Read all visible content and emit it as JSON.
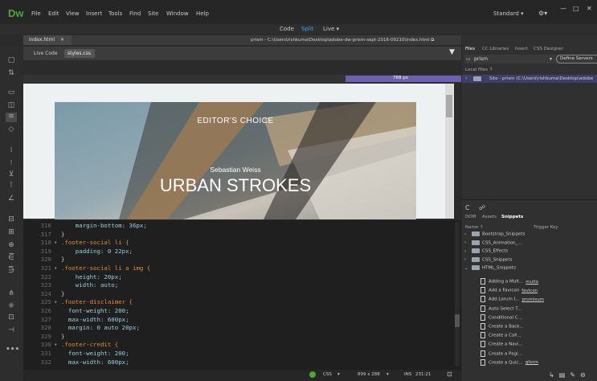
{
  "app": {
    "logo": "Dw",
    "accent": "#4ea53a"
  },
  "menu": [
    "File",
    "Edit",
    "View",
    "Insert",
    "Tools",
    "Find",
    "Site",
    "Window",
    "Help"
  ],
  "workspace": "Standard",
  "window_controls": {
    "minimize": "—",
    "maximize": "□",
    "close": "✕"
  },
  "view_modes": {
    "code": "Code",
    "split": "Split",
    "live": "Live"
  },
  "doc_tab": "index.html",
  "doc_path": "prism - C:\\Users\\rishkuma\\Desktop\\adobe-dw-prism-sept-2016-09210\\index.html",
  "related_files": [
    "Live Code",
    "styles.css"
  ],
  "media_query": "768 px",
  "preview": {
    "kicker": "EDITOR'S CHOICE",
    "author": "Sebastian Weiss",
    "headline": "URBAN STROKES"
  },
  "code_lines": [
    {
      "n": "316",
      "text": "    margin-bottom: 36px;",
      "kind": "prop"
    },
    {
      "n": "317",
      "text": "}",
      "kind": "brace"
    },
    {
      "n": "318",
      "text": ".footer-social li {",
      "kind": "sel",
      "fold": true
    },
    {
      "n": "319",
      "text": "    padding: 0 22px;",
      "kind": "prop"
    },
    {
      "n": "320",
      "text": "}",
      "kind": "brace"
    },
    {
      "n": "321",
      "text": ".footer-social li a img {",
      "kind": "sel",
      "fold": true
    },
    {
      "n": "322",
      "text": "    height: 20px;",
      "kind": "prop"
    },
    {
      "n": "323",
      "text": "    width: auto;",
      "kind": "prop"
    },
    {
      "n": "324",
      "text": "}",
      "kind": "brace"
    },
    {
      "n": "325",
      "text": ".footer-disclaimer {",
      "kind": "sel",
      "fold": true
    },
    {
      "n": "326",
      "text": "  font-weight: 200;",
      "kind": "prop"
    },
    {
      "n": "327",
      "text": "  max-width: 600px;",
      "kind": "prop"
    },
    {
      "n": "328",
      "text": "  margin: 0 auto 20px;",
      "kind": "prop"
    },
    {
      "n": "329",
      "text": "}",
      "kind": "brace"
    },
    {
      "n": "330",
      "text": ".footer-credit {",
      "kind": "sel",
      "fold": true
    },
    {
      "n": "331",
      "text": "  font-weight: 200;",
      "kind": "prop"
    },
    {
      "n": "332",
      "text": "  max-width: 600px;",
      "kind": "prop"
    }
  ],
  "status": {
    "lang": "CSS",
    "size": "899 x 288",
    "mode": "INS",
    "pos": "231:21"
  },
  "files_panel": {
    "tabs": [
      "Files",
      "CC Libraries",
      "Insert",
      "CSS Designer"
    ],
    "site": "prism",
    "define_servers": "Define Servers",
    "local_files": "Local Files ↑",
    "site_row": "Site - prism (C:\\Users\\rishkuma\\Desktop\\adobe"
  },
  "snippets_panel": {
    "tabs": [
      "DOM",
      "Assets",
      "Snippets"
    ],
    "col_name": "Name ↑",
    "col_trigger": "Trigger Key",
    "folders": [
      "Bootstrap_Snippets",
      "CSS_Animation_...",
      "CSS_Effects",
      "CSS_Snippets",
      "HTML_Snippets"
    ],
    "items": [
      {
        "name": "Adding a Mult...",
        "key": "multo"
      },
      {
        "name": "Add a Favicon",
        "key": "favicon"
      },
      {
        "name": "Add Lorum I...",
        "key": "promisum"
      },
      {
        "name": "Auto Select T...",
        "key": ""
      },
      {
        "name": "Conditional C...",
        "key": ""
      },
      {
        "name": "Create a Back...",
        "key": ""
      },
      {
        "name": "Create a Call...",
        "key": ""
      },
      {
        "name": "Create a Navi...",
        "key": ""
      },
      {
        "name": "Create a Pagi...",
        "key": ""
      },
      {
        "name": "Create a Quic...",
        "key": "qform"
      }
    ]
  }
}
